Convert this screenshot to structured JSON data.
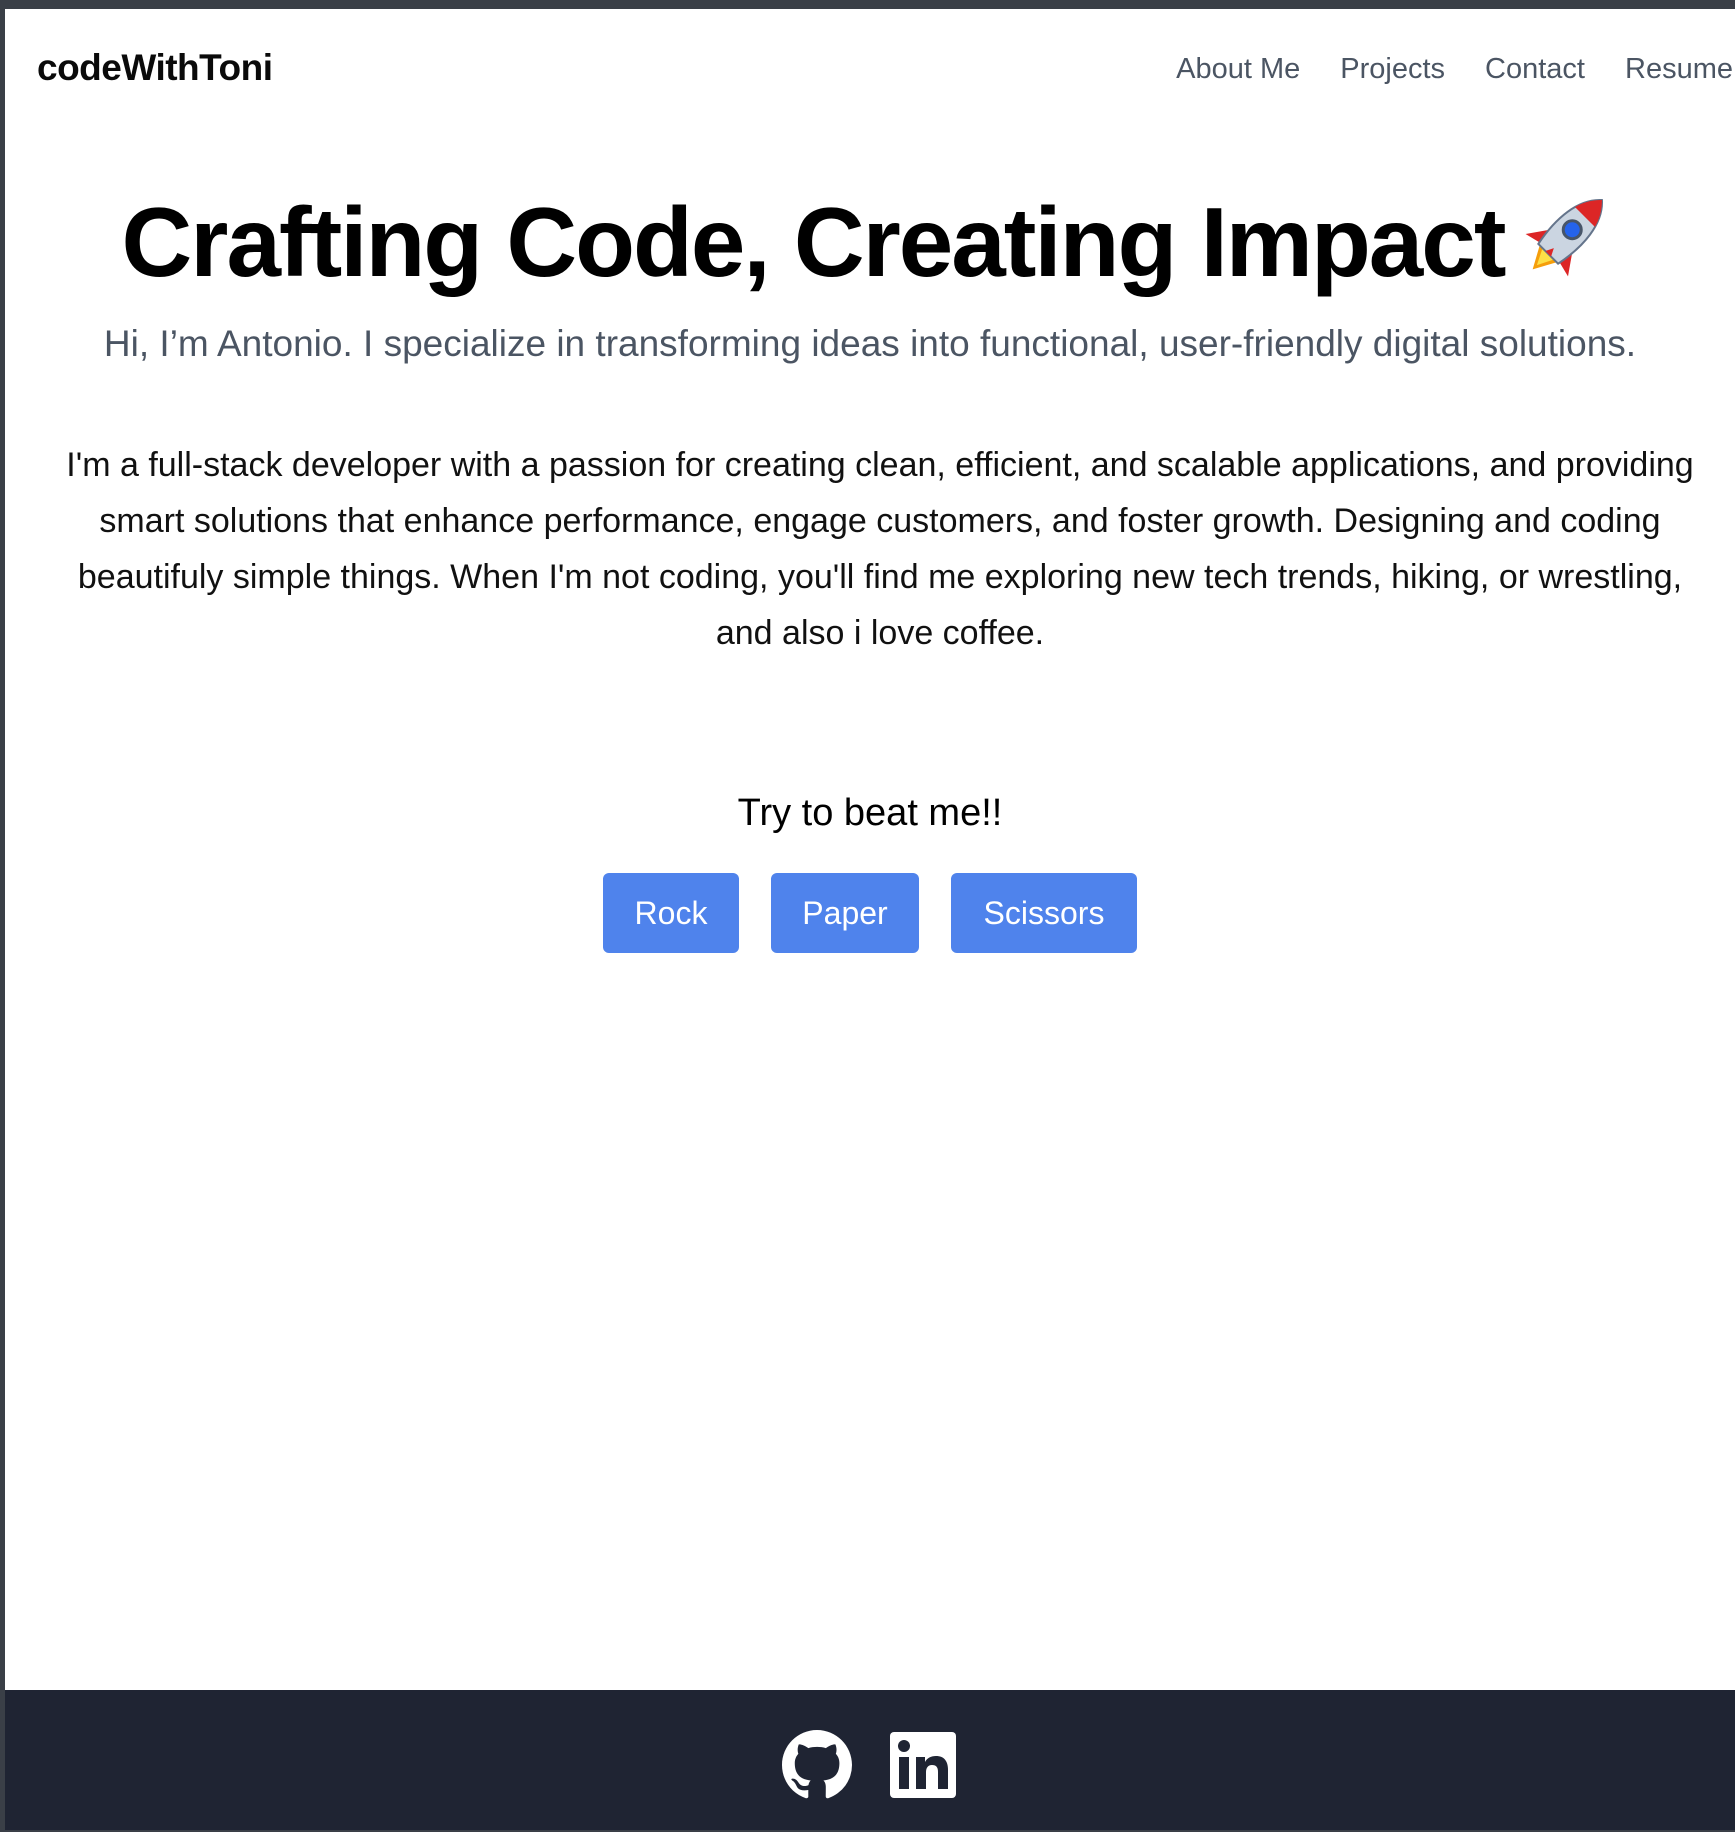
{
  "header": {
    "brand": "codeWithToni",
    "nav": [
      "About Me",
      "Projects",
      "Contact",
      "Resume"
    ]
  },
  "hero": {
    "title": "Crafting Code, Creating Impact",
    "title_icon": "rocket-icon",
    "subtitle": "Hi, I’m Antonio. I specialize in transforming ideas into functional, user-friendly digital solutions.",
    "bio": "I'm a full-stack developer with a passion for creating clean, efficient, and scalable applications, and providing smart solutions that enhance performance, engage customers, and foster growth. Designing and coding beautifuly simple things. When I'm not coding, you'll find me exploring new tech trends, hiking, or wrestling, and also i love coffee."
  },
  "game": {
    "title": "Try to beat me!!",
    "buttons": [
      "Rock",
      "Paper",
      "Scissors"
    ],
    "button_color": "#4f83ec"
  },
  "footer": {
    "icons": [
      "github-icon",
      "linkedin-icon"
    ],
    "background": "#1f2433"
  }
}
